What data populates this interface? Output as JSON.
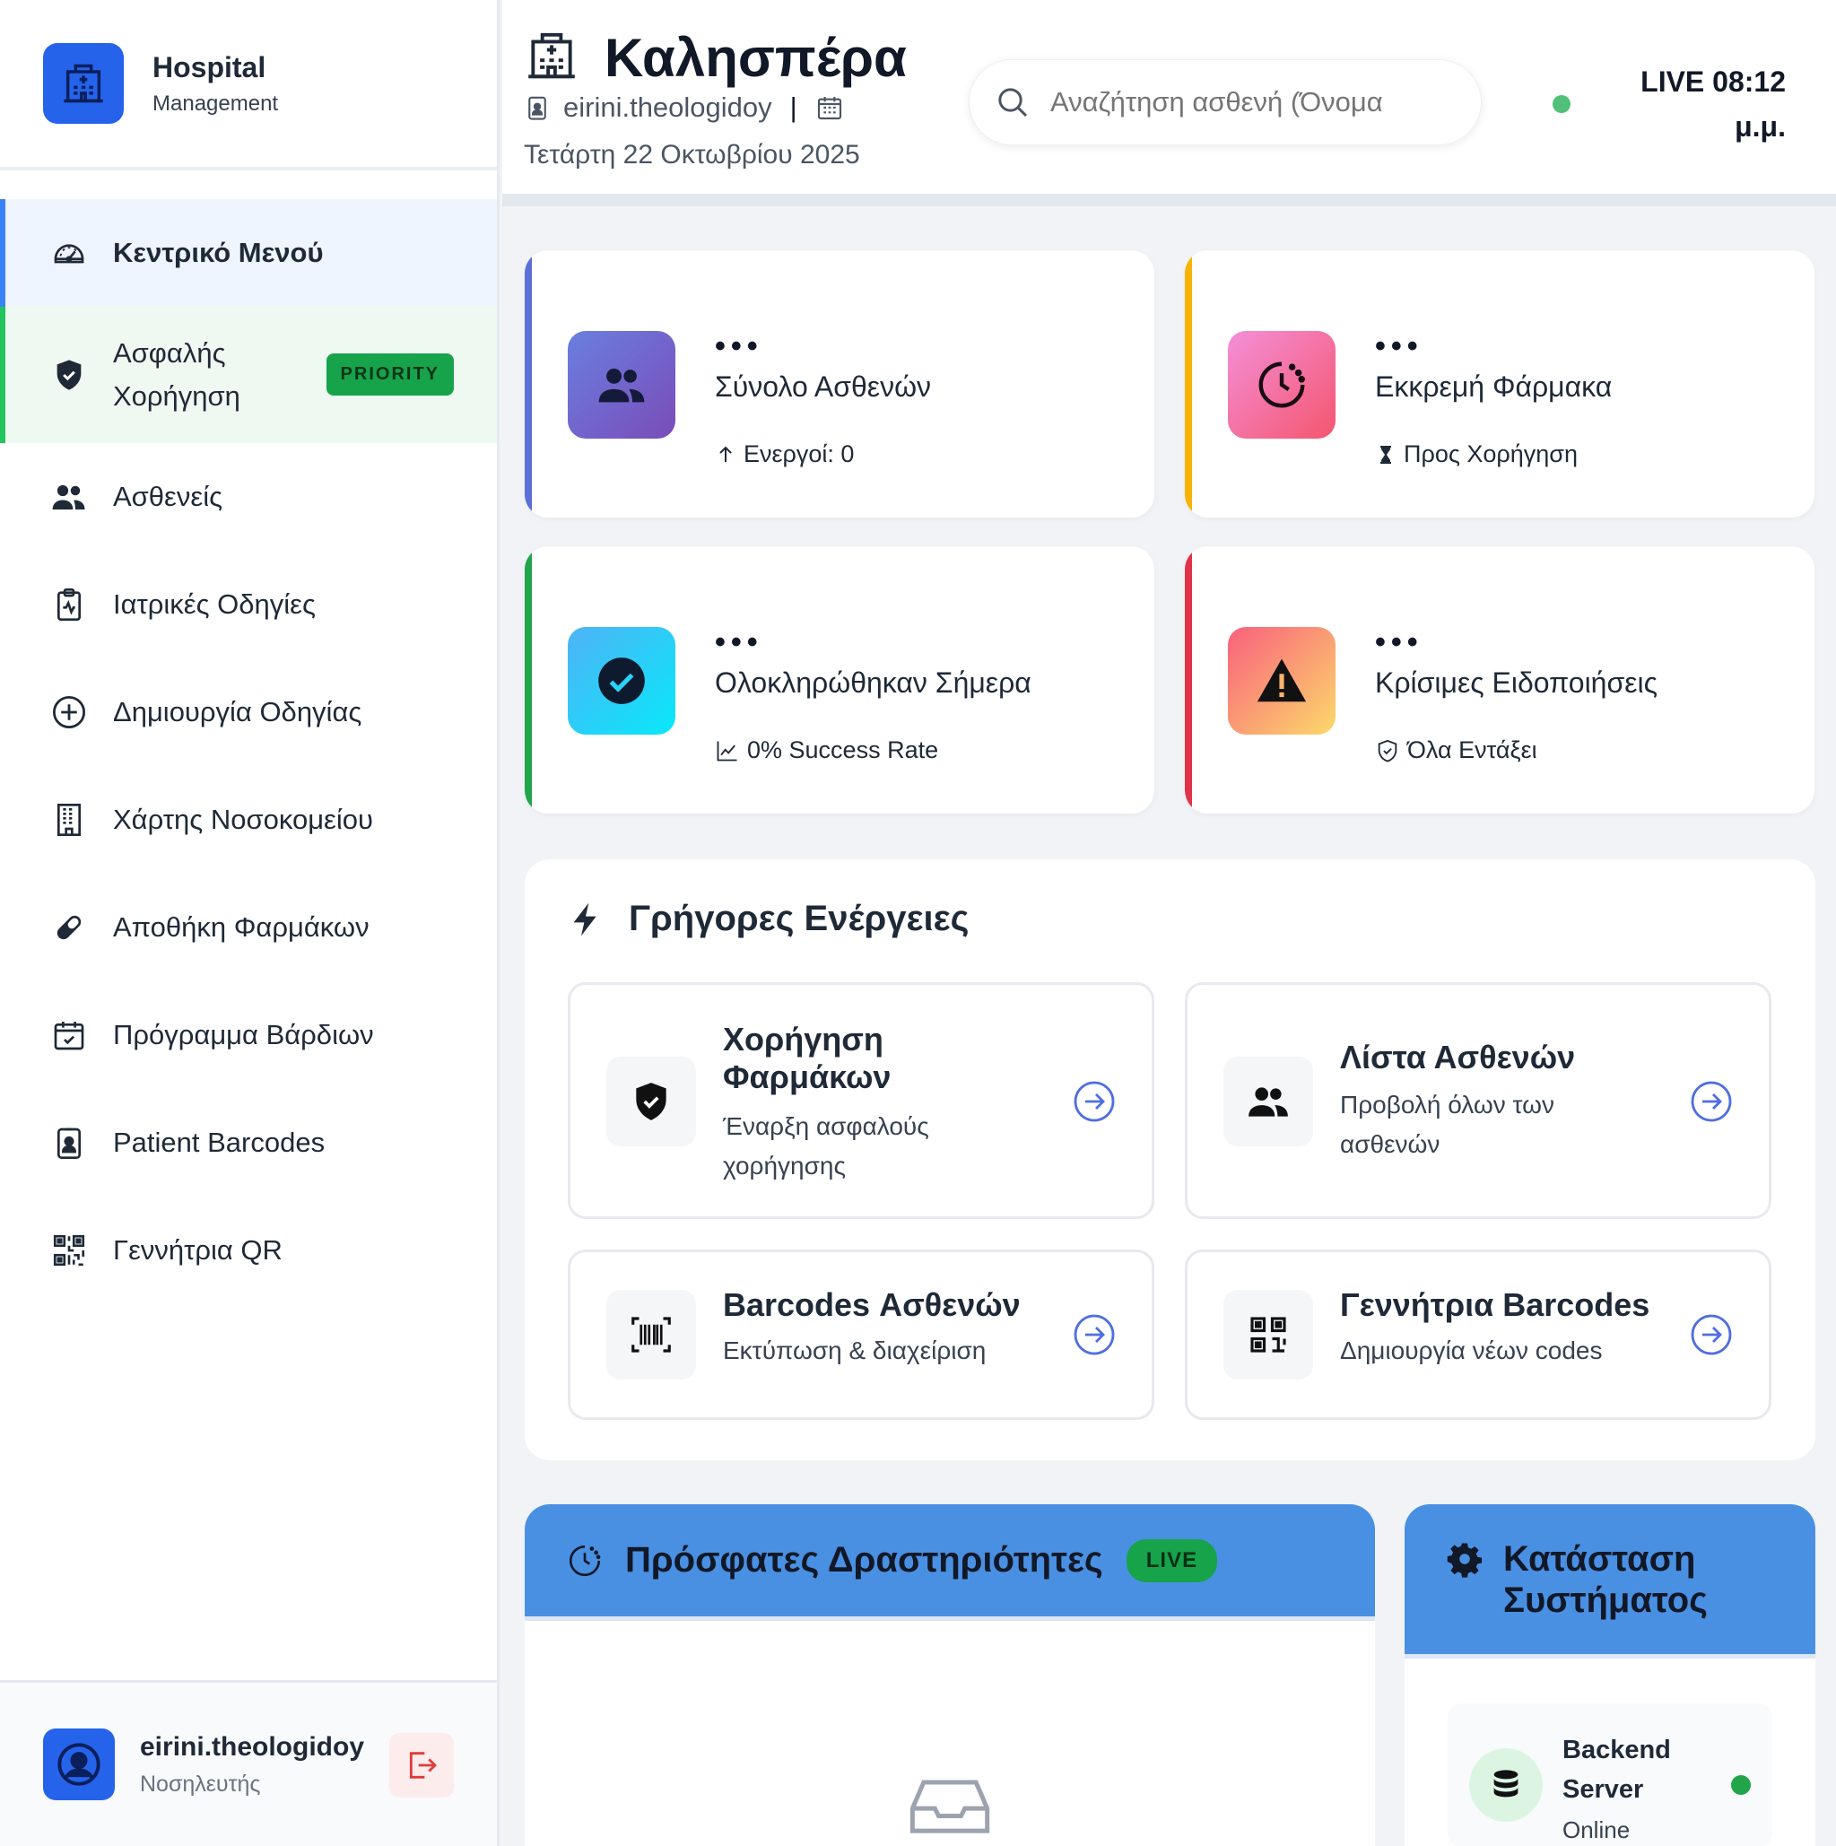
{
  "brand": {
    "title": "Hospital",
    "subtitle": "Management"
  },
  "sidebar": {
    "items": [
      {
        "label": "Κεντρικό Μενού",
        "icon": "dashboard-gauge-icon"
      },
      {
        "label": "Ασφαλής Χορήγηση",
        "icon": "shield-check-icon",
        "badge": "PRIORITY"
      },
      {
        "label": "Ασθενείς",
        "icon": "users-icon"
      },
      {
        "label": "Ιατρικές Οδηγίες",
        "icon": "clipboard-pulse-icon"
      },
      {
        "label": "Δημιουργία Οδηγίας",
        "icon": "plus-circle-icon"
      },
      {
        "label": "Χάρτης Νοσοκομείου",
        "icon": "building-icon"
      },
      {
        "label": "Αποθήκη Φαρμάκων",
        "icon": "pill-icon"
      },
      {
        "label": "Πρόγραμμα Βάρδιων",
        "icon": "calendar-check-icon"
      },
      {
        "label": "Patient Barcodes",
        "icon": "id-badge-icon"
      },
      {
        "label": "Γεννήτρια QR",
        "icon": "qr-code-icon"
      }
    ]
  },
  "user": {
    "name": "eirini.theologidoy",
    "role": "Νοσηλευτής"
  },
  "header": {
    "greeting": "Καλησπέρα",
    "username": "eirini.theologidoy",
    "separator": "|",
    "date": "Τετάρτη 22 Οκτωβρίου 2025",
    "search_placeholder": "Αναζήτηση ασθενή (Όνομα",
    "clock": "LIVE 08:12 μ.μ."
  },
  "stats": [
    {
      "dots": "•••",
      "title": "Σύνολο Ασθενών",
      "sub": "Ενεργοί: 0",
      "accent": "#5b6fd6"
    },
    {
      "dots": "•••",
      "title": "Εκκρεμή Φάρμακα",
      "sub": "Προς Χορήγηση",
      "accent": "#f5b400"
    },
    {
      "dots": "•••",
      "title": "Ολοκληρώθηκαν Σήμερα",
      "sub": "0% Success Rate",
      "accent": "#22a44a"
    },
    {
      "dots": "•••",
      "title": "Κρίσιμες Ειδοποιήσεις",
      "sub": "Όλα Εντάξει",
      "accent": "#e0334a"
    }
  ],
  "quick": {
    "title": "Γρήγορες Ενέργειες",
    "actions": [
      {
        "title": "Χορήγηση Φαρμάκων",
        "desc": "Έναρξη ασφαλούς χορήγησης"
      },
      {
        "title": "Λίστα Ασθενών",
        "desc": "Προβολή όλων των ασθενών"
      },
      {
        "title": "Barcodes Ασθενών",
        "desc": "Εκτύπωση & διαχείριση"
      },
      {
        "title": "Γεννήτρια Barcodes",
        "desc": "Δημιουργία νέων codes"
      }
    ]
  },
  "activity": {
    "title": "Πρόσφατες Δραστηριότητες",
    "badge": "LIVE"
  },
  "system": {
    "title": "Κατάσταση Συστήματος",
    "server_name": "Backend Server",
    "server_status": "Online"
  },
  "colors": {
    "primary": "#2563eb",
    "header_blue": "#4a90e2",
    "success": "#22a44a"
  }
}
